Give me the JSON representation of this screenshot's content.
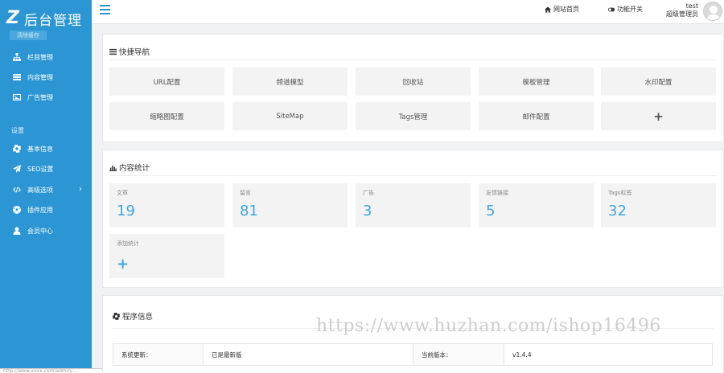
{
  "app": {
    "logo_mark": "Z",
    "logo_text": "后台管理",
    "clear_cache": "清除缓存"
  },
  "sidebar": {
    "items": [
      {
        "label": "栏目管理",
        "icon": "sitemap-icon"
      },
      {
        "label": "内容管理",
        "icon": "list-icon"
      },
      {
        "label": "广告管理",
        "icon": "image-icon"
      }
    ],
    "section_label": "设置",
    "settings": [
      {
        "label": "基本信息",
        "icon": "gear-icon"
      },
      {
        "label": "SEO设置",
        "icon": "paper-plane-icon"
      },
      {
        "label": "高级选项",
        "icon": "code-icon",
        "arrow": "›"
      },
      {
        "label": "插件应用",
        "icon": "soccer-ball-icon"
      },
      {
        "label": "会员中心",
        "icon": "user-icon"
      }
    ],
    "bottom_url": "http://www.xxxx.com/admin/..."
  },
  "topbar": {
    "home_link": "网站首页",
    "feature_switch": "功能开关",
    "username": "test",
    "role": "超级管理员"
  },
  "quick_nav": {
    "title": "快捷导航",
    "items": [
      "URL配置",
      "频道模型",
      "回收站",
      "模板管理",
      "水印配置",
      "缩略图配置",
      "SiteMap",
      "Tags管理",
      "邮件配置",
      "+"
    ]
  },
  "stats": {
    "title": "内容统计",
    "cards": [
      {
        "label": "文章",
        "value": "19"
      },
      {
        "label": "留言",
        "value": "81"
      },
      {
        "label": "广告",
        "value": "3"
      },
      {
        "label": "友情链接",
        "value": "5"
      },
      {
        "label": "Tags标签",
        "value": "32"
      },
      {
        "label": "添加统计",
        "value": "+"
      }
    ]
  },
  "program_info": {
    "title": "程序信息",
    "row": {
      "label1": "系统更新：",
      "value1": "已是最新版",
      "label2": "当前版本：",
      "value2": "v1.4.4"
    }
  },
  "watermark": "https://www.huzhan.com/ishop16496",
  "colors": {
    "sidebar": "#2b96d3",
    "accent": "#3fa6dc"
  }
}
